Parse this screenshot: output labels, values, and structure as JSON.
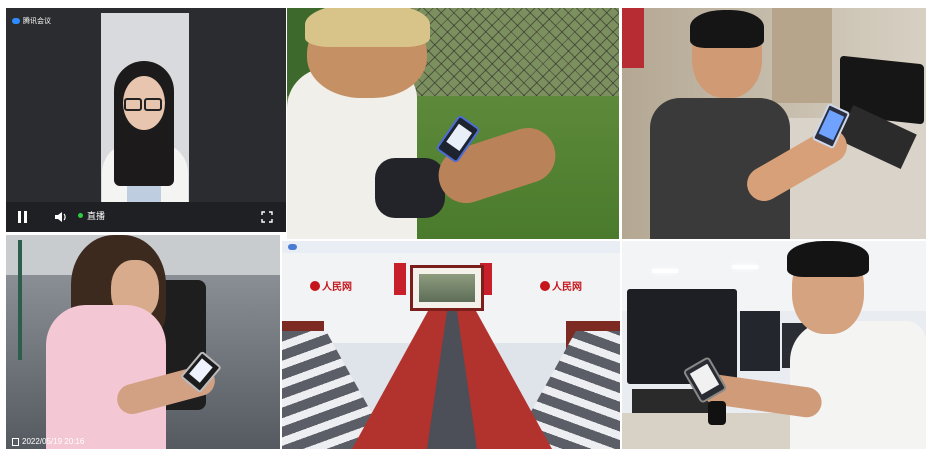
{
  "video_player": {
    "brand": "腾讯会议",
    "live_label": "直播",
    "icons": [
      "pause-icon",
      "volume-icon",
      "fullscreen-icon"
    ],
    "live_dot_color": "#2ecc40"
  },
  "court_tile": {
    "timestamp": "2022/05/19 20:16"
  },
  "conference_tile": {
    "top_bar_text": "",
    "logo_left": "人民网",
    "logo_right": "人民网",
    "brand_color": "#c4161c"
  },
  "tiles": [
    {
      "id": "video-player",
      "subject": "woman with glasses in video call"
    },
    {
      "id": "grass",
      "subject": "young man sitting on grass using phone"
    },
    {
      "id": "gaming-desk",
      "subject": "young man at computer desk using phone"
    },
    {
      "id": "court",
      "subject": "young woman on court using phone"
    },
    {
      "id": "conference",
      "subject": "conference room with red table"
    },
    {
      "id": "computer-lab",
      "subject": "young man in computer lab using phone"
    }
  ]
}
